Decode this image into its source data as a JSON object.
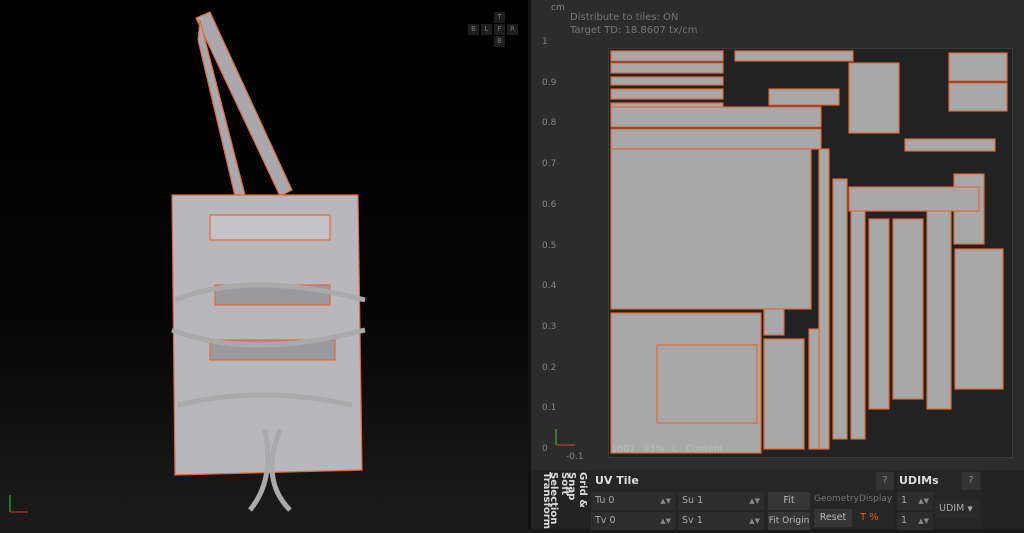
{
  "viewport": {
    "cube": {
      "top": "T",
      "left": "B",
      "l": "L",
      "front": "F",
      "right": "R",
      "bottom": "B"
    }
  },
  "uv_editor": {
    "unit": "cm",
    "distribute": "Distribute to tiles: ON",
    "target_td": "Target TD: 18.8607 tx/cm",
    "v_ticks": [
      "1",
      "0.9",
      "0.8",
      "0.7",
      "0.6",
      "0.5",
      "0.4",
      "0.3",
      "0.2",
      "0.1",
      "0"
    ],
    "u_ticks": [
      "-0.1"
    ],
    "status": {
      "tile": "1001",
      "zoom": "93%",
      "mode": "L",
      "content": "Content"
    },
    "colors": {
      "island_fill": "#a8a8a8",
      "island_outline": "#e0683a",
      "background": "#2c2c2c"
    }
  },
  "panel": {
    "tabs": [
      "Transform",
      "Soft Selection",
      "Grid & Snap"
    ],
    "uv_tile": {
      "title": "UV Tile",
      "help": "?",
      "tu_label": "Tu",
      "tu": "0",
      "tv_label": "Tv",
      "tv": "0",
      "su_label": "Su",
      "su": "1",
      "sv_label": "Sv",
      "sv": "1",
      "fit": "Fit",
      "fit_origin": "Fit Origin",
      "geometry": "Geometry",
      "display": "Display",
      "reset": "Reset"
    },
    "udims": {
      "title": "UDIMs",
      "help": "?",
      "u": "1",
      "v": "1",
      "mode": "UDIM"
    }
  }
}
